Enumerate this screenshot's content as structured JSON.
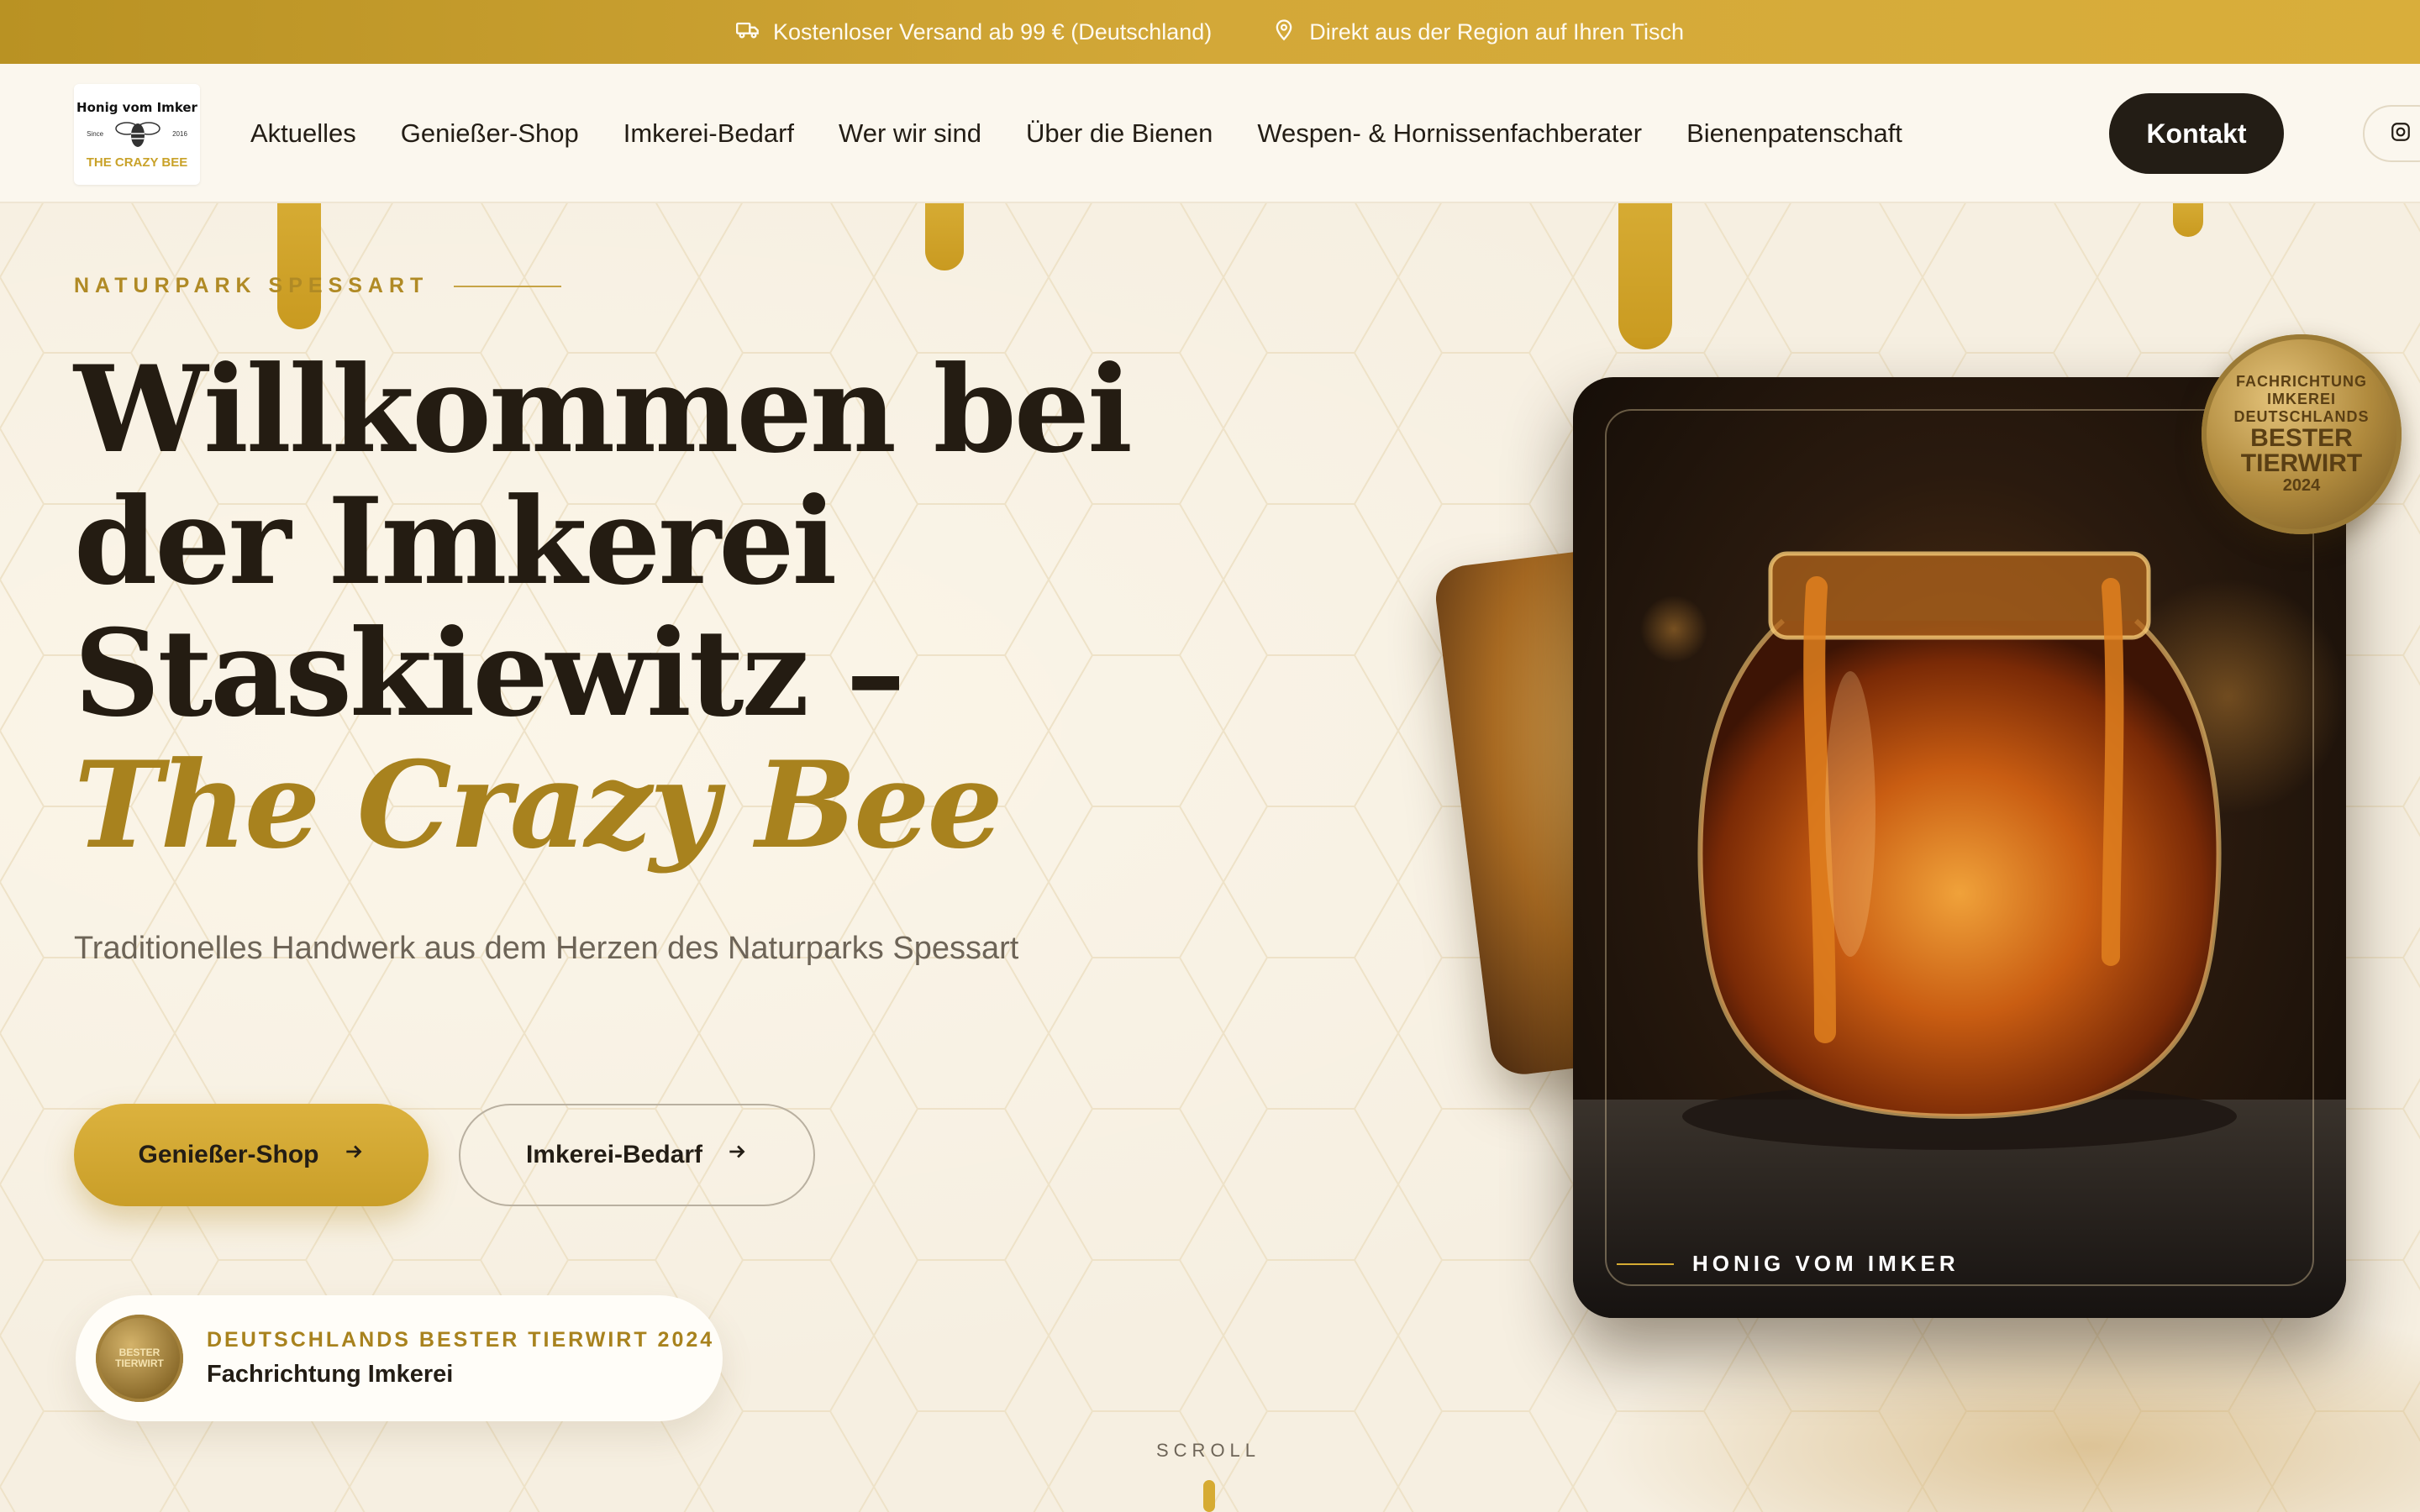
{
  "topbar": {
    "shipping_icon": "truck-icon",
    "shipping_text": "Kostenloser Versand ab 99 € (Deutschland)",
    "region_icon": "map-pin-icon",
    "region_text": "Direkt aus der Region auf Ihren Tisch"
  },
  "header": {
    "logo": {
      "line1": "Honig vom Imker",
      "since": "Since",
      "year": "2016",
      "line2": "THE CRAZY BEE"
    },
    "nav": [
      {
        "label": "Aktuelles"
      },
      {
        "label": "Genießer-Shop"
      },
      {
        "label": "Imkerei-Bedarf"
      },
      {
        "label": "Wer wir sind"
      },
      {
        "label": "Über die Bienen"
      },
      {
        "label": "Wespen- & Hornissenfachberater"
      },
      {
        "label": "Bienenpatenschaft"
      }
    ],
    "contact_label": "Kontakt",
    "right_icon": "instagram-icon"
  },
  "hero": {
    "eyebrow": "NATURPARK SPESSART",
    "headline_line1": "Willkommen bei",
    "headline_line2": "der Imkerei",
    "headline_line3": "Staskiewitz –",
    "headline_accent": "The Crazy Bee",
    "subline": "Traditionelles Handwerk aus dem Herzen des Naturparks Spessart",
    "primary_button": "Genießer-Shop",
    "secondary_button": "Imkerei-Bedarf",
    "award": {
      "title": "DEUTSCHLANDS BESTER TIERWIRT 2024",
      "subtitle": "Fachrichtung Imkerei",
      "medal_text": "BESTER TIERWIRT"
    },
    "scroll_label": "SCROLL",
    "card_caption": "HONIG VOM IMKER",
    "seal": {
      "top": "FACHRICHTUNG IMKEREI",
      "middle_a": "DEUTSCHLANDS",
      "middle_b": "BESTER",
      "middle_c": "TIERWIRT",
      "year": "2024"
    }
  },
  "colors": {
    "gold": "#d6ab33",
    "dark": "#231d15",
    "cream": "#f6efe1",
    "accent_text": "#a8821e"
  }
}
